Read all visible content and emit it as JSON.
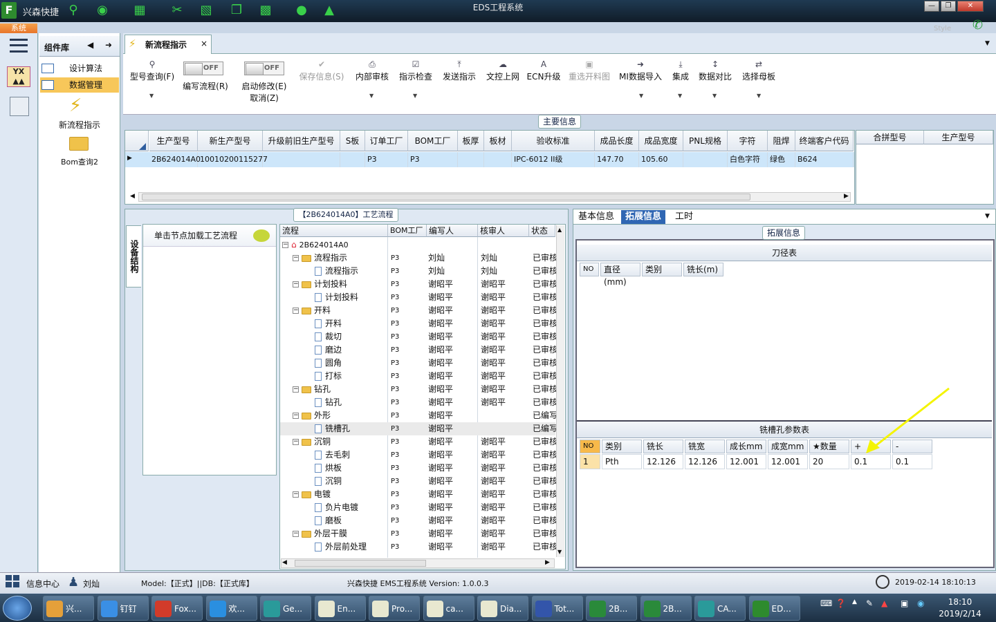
{
  "app": {
    "name": "兴森快捷",
    "window_title": "EDS工程系统",
    "system_button": "系统",
    "style_label": "Style"
  },
  "window_controls": {
    "minimize": "—",
    "restore": "❐",
    "close": "✕"
  },
  "left_panel": {
    "title": "组件库",
    "items": [
      {
        "label": "设计算法"
      },
      {
        "label": "数据管理"
      }
    ],
    "large_items": [
      {
        "label": "新流程指示"
      },
      {
        "label": "Bom查询2"
      }
    ]
  },
  "document_tab": {
    "label": "新流程指示",
    "close": "×"
  },
  "toolbar": {
    "items": [
      {
        "label": "型号查询(F)"
      },
      {
        "label": "编写流程(R)",
        "toggle": "OFF"
      },
      {
        "label": "启动修改(E)",
        "sub": "取消(Z)",
        "toggle": "OFF"
      },
      {
        "label": "保存信息(S)"
      },
      {
        "label": "内部审核"
      },
      {
        "label": "指示检查"
      },
      {
        "label": "发送指示"
      },
      {
        "label": "文控上网"
      },
      {
        "label": "ECN升级"
      },
      {
        "label": "重选开料图"
      },
      {
        "label": "MI数据导入"
      },
      {
        "label": "集成"
      },
      {
        "label": "数据对比"
      },
      {
        "label": "选择母板"
      }
    ]
  },
  "main_info": {
    "caption": "主要信息",
    "columns": [
      "生产型号",
      "新生产型号",
      "升级前旧生产型号",
      "S板",
      "订单工厂",
      "BOM工厂",
      "板厚",
      "板材",
      "验收标准",
      "成品长度",
      "成品宽度",
      "PNL规格",
      "字符",
      "阻焊",
      "终端客户代码"
    ],
    "row": [
      "2B624014A0",
      "10010200115277",
      "",
      "",
      "P3",
      "P3",
      "",
      "",
      "IPC-6012 II级",
      "147.70",
      "105.60",
      "",
      "白色字符",
      "绿色",
      "B624"
    ],
    "side_columns": [
      "合拼型号",
      "生产型号"
    ]
  },
  "process": {
    "caption": "【2B624014A0】工艺流程",
    "vertical_tab": "设备结构",
    "hint": "单击节点加载工艺流程",
    "columns": [
      "流程",
      "BOM工厂",
      "编写人",
      "核审人",
      "状态"
    ],
    "root": "2B624014A0",
    "rows": [
      {
        "level": 1,
        "name": "流程指示",
        "bom": "P3",
        "author": "刘灿",
        "reviewer": "刘灿",
        "status": "已审核"
      },
      {
        "level": 2,
        "name": "流程指示",
        "bom": "P3",
        "author": "刘灿",
        "reviewer": "刘灿",
        "status": "已审核"
      },
      {
        "level": 1,
        "name": "计划投料",
        "bom": "P3",
        "author": "谢昭平",
        "reviewer": "谢昭平",
        "status": "已审核"
      },
      {
        "level": 2,
        "name": "计划投料",
        "bom": "P3",
        "author": "谢昭平",
        "reviewer": "谢昭平",
        "status": "已审核"
      },
      {
        "level": 1,
        "name": "开料",
        "bom": "P3",
        "author": "谢昭平",
        "reviewer": "谢昭平",
        "status": "已审核"
      },
      {
        "level": 2,
        "name": "开料",
        "bom": "P3",
        "author": "谢昭平",
        "reviewer": "谢昭平",
        "status": "已审核"
      },
      {
        "level": 2,
        "name": "裁切",
        "bom": "P3",
        "author": "谢昭平",
        "reviewer": "谢昭平",
        "status": "已审核"
      },
      {
        "level": 2,
        "name": "磨边",
        "bom": "P3",
        "author": "谢昭平",
        "reviewer": "谢昭平",
        "status": "已审核"
      },
      {
        "level": 2,
        "name": "圆角",
        "bom": "P3",
        "author": "谢昭平",
        "reviewer": "谢昭平",
        "status": "已审核"
      },
      {
        "level": 2,
        "name": "打标",
        "bom": "P3",
        "author": "谢昭平",
        "reviewer": "谢昭平",
        "status": "已审核"
      },
      {
        "level": 1,
        "name": "钻孔",
        "bom": "P3",
        "author": "谢昭平",
        "reviewer": "谢昭平",
        "status": "已审核"
      },
      {
        "level": 2,
        "name": "钻孔",
        "bom": "P3",
        "author": "谢昭平",
        "reviewer": "谢昭平",
        "status": "已审核"
      },
      {
        "level": 1,
        "name": "外形",
        "bom": "P3",
        "author": "谢昭平",
        "reviewer": "",
        "status": "已编写"
      },
      {
        "level": 2,
        "name": "铣槽孔",
        "bom": "P3",
        "author": "谢昭平",
        "reviewer": "",
        "status": "已编写",
        "selected": true
      },
      {
        "level": 1,
        "name": "沉铜",
        "bom": "P3",
        "author": "谢昭平",
        "reviewer": "谢昭平",
        "status": "已审核"
      },
      {
        "level": 2,
        "name": "去毛刺",
        "bom": "P3",
        "author": "谢昭平",
        "reviewer": "谢昭平",
        "status": "已审核"
      },
      {
        "level": 2,
        "name": "烘板",
        "bom": "P3",
        "author": "谢昭平",
        "reviewer": "谢昭平",
        "status": "已审核"
      },
      {
        "level": 2,
        "name": "沉铜",
        "bom": "P3",
        "author": "谢昭平",
        "reviewer": "谢昭平",
        "status": "已审核"
      },
      {
        "level": 1,
        "name": "电镀",
        "bom": "P3",
        "author": "谢昭平",
        "reviewer": "谢昭平",
        "status": "已审核"
      },
      {
        "level": 2,
        "name": "负片电镀",
        "bom": "P3",
        "author": "谢昭平",
        "reviewer": "谢昭平",
        "status": "已审核"
      },
      {
        "level": 2,
        "name": "磨板",
        "bom": "P3",
        "author": "谢昭平",
        "reviewer": "谢昭平",
        "status": "已审核"
      },
      {
        "level": 1,
        "name": "外层干膜",
        "bom": "P3",
        "author": "谢昭平",
        "reviewer": "谢昭平",
        "status": "已审核"
      },
      {
        "level": 2,
        "name": "外层前处理",
        "bom": "P3",
        "author": "谢昭平",
        "reviewer": "谢昭平",
        "status": "已审核"
      }
    ]
  },
  "right_panel": {
    "tabs": [
      "基本信息",
      "拓展信息",
      "工时"
    ],
    "active_tab": "拓展信息",
    "caption": "拓展信息",
    "cutter_table": {
      "title": "刀径表",
      "columns": [
        "NO",
        "直径(mm)",
        "类别",
        "铣长(m)"
      ]
    },
    "slot_table": {
      "title": "铣槽孔参数表",
      "columns": [
        "NO",
        "类别",
        "铣长(mm)",
        "铣宽(mm)",
        "成长mm",
        "成宽mm",
        "★数量",
        "+",
        "-"
      ],
      "rows": [
        [
          "1",
          "Pth",
          "12.126",
          "12.126",
          "12.001",
          "12.001",
          "20",
          "0.1",
          "0.1"
        ]
      ]
    },
    "arrow_color": "#f4f400"
  },
  "status_bar": {
    "info_center": "信息中心",
    "user": "刘灿",
    "model_db": "Model:【正式】||DB:【正式库】",
    "version": "兴森快捷  EMS工程系统  Version: 1.0.0.3",
    "datetime": "2019-02-14 18:10:13"
  },
  "taskbar": {
    "items": [
      {
        "label": "兴...",
        "color": "#e5a03a"
      },
      {
        "label": "钉钉",
        "color": "#3a8fe5"
      },
      {
        "label": "Fox...",
        "color": "#d23b2a"
      },
      {
        "label": "欢...",
        "color": "#2a8fe0"
      },
      {
        "label": "Ge...",
        "color": "#2a9a9a"
      },
      {
        "label": "En...",
        "color": "#e8e8d0"
      },
      {
        "label": "Pro...",
        "color": "#e8e8d0"
      },
      {
        "label": "ca...",
        "color": "#e8e8d0"
      },
      {
        "label": "Dia...",
        "color": "#e8e8d0"
      },
      {
        "label": "Tot...",
        "color": "#3355aa"
      },
      {
        "label": "2B...",
        "color": "#2a8a3a"
      },
      {
        "label": "2B...",
        "color": "#2a8a3a"
      },
      {
        "label": "CA...",
        "color": "#2a9a9a"
      },
      {
        "label": "ED...",
        "color": "#2e8b2e"
      }
    ],
    "time": "18:10",
    "date": "2019/2/14"
  }
}
